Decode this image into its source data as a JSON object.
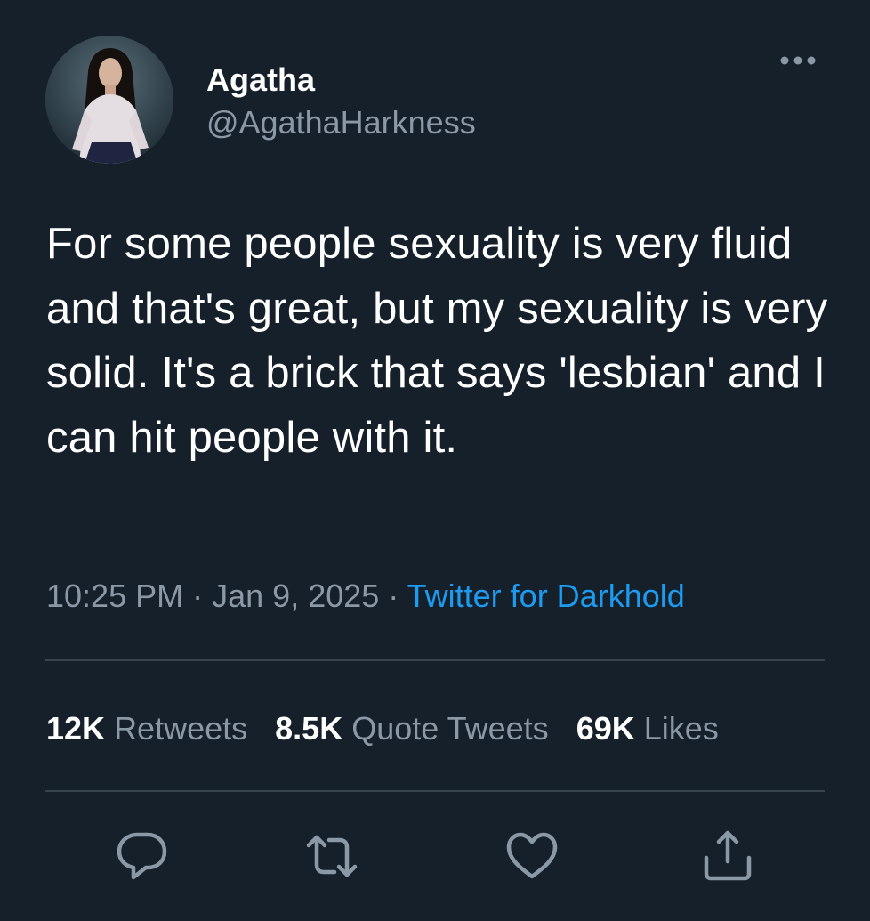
{
  "author": {
    "name": "Agatha",
    "handle": "@AgathaHarkness"
  },
  "tweet": {
    "text": "For some people sexuality is very fluid and that's great, but my sexuality is very solid. It's a brick that says 'lesbian' and I can hit people with it.",
    "time": "10:25 PM",
    "date": "Jan 9, 2025",
    "separator": "·",
    "source": "Twitter for Darkhold"
  },
  "stats": {
    "retweets": {
      "count": "12K",
      "label": "Retweets"
    },
    "quote_tweets": {
      "count": "8.5K",
      "label": "Quote Tweets"
    },
    "likes": {
      "count": "69K",
      "label": "Likes"
    }
  },
  "actions": [
    "reply-icon",
    "retweet-icon",
    "like-icon",
    "share-icon"
  ],
  "colors": {
    "background": "#15202b",
    "text": "#ffffff",
    "secondary_text": "#8b98a5",
    "link": "#1d9bf0",
    "divider": "#38444d"
  }
}
